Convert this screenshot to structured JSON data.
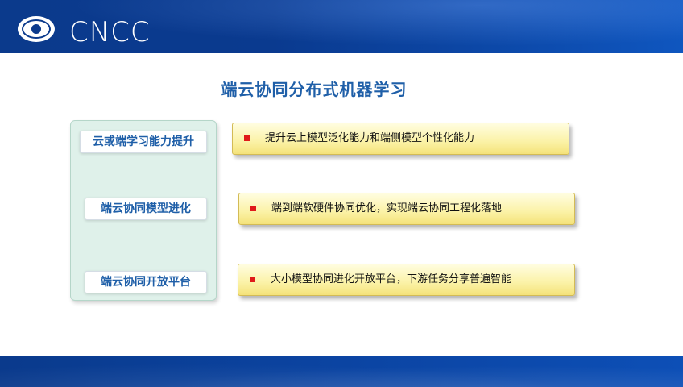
{
  "header": {
    "brand": "CNCC",
    "logo_icon": "ccf-emblem-icon"
  },
  "slide": {
    "title": "端云协同分布式机器学习",
    "left_labels": [
      "云或端学习能力提升",
      "端云协同模型进化",
      "端云协同开放平台"
    ],
    "points": [
      "提升云上模型泛化能力和端侧模型个性化能力",
      "端到端软硬件协同优化，实现端云协同工程化落地",
      "大小模型协同进化开放平台，下游任务分享普遍智能"
    ]
  },
  "colors": {
    "header_blue": "#0b3a8c",
    "title_blue": "#1f5fa8",
    "panel_green": "#dff1ea",
    "box_yellow": "#fbf2a6",
    "bullet_red": "#e01a1a"
  }
}
